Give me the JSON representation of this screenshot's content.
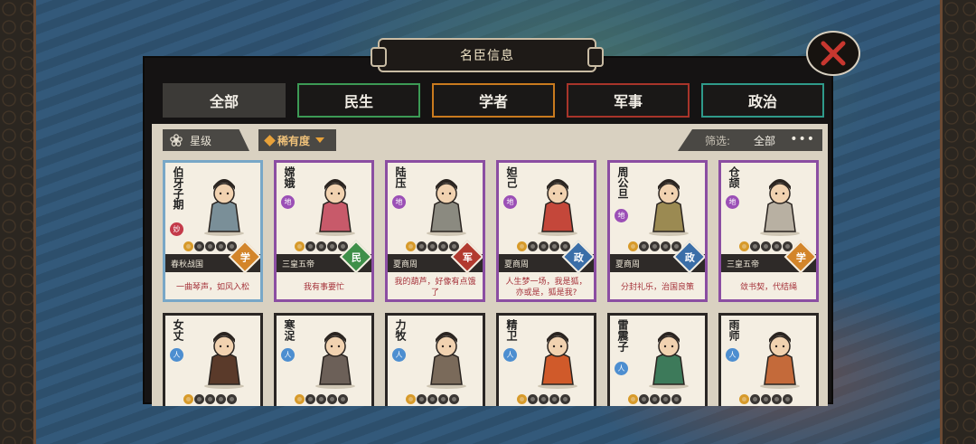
{
  "header": {
    "title": "名臣信息"
  },
  "tabs": [
    {
      "label": "全部",
      "key": "all"
    },
    {
      "label": "民生",
      "key": "min"
    },
    {
      "label": "学者",
      "key": "xue"
    },
    {
      "label": "军事",
      "key": "jun"
    },
    {
      "label": "政治",
      "key": "zheng"
    }
  ],
  "filters": {
    "star_label": "星级",
    "rarity_label": "稀有度",
    "filter_label": "筛选:",
    "filter_value": "全部",
    "more": "•••"
  },
  "cards": [
    {
      "name": "伯牙子期",
      "badge": "妙",
      "stars": 5,
      "dynasty": "春秋战国",
      "category": "学",
      "quote": "一曲琴声，如风入松"
    },
    {
      "name": "嫦娥",
      "badge": "地",
      "stars": 5,
      "dynasty": "三皇五帝",
      "category": "民",
      "quote": "我有事要忙"
    },
    {
      "name": "陆压",
      "badge": "地",
      "stars": 5,
      "dynasty": "夏商周",
      "category": "军",
      "quote": "我的葫芦，好像有点饿了"
    },
    {
      "name": "妲己",
      "badge": "地",
      "stars": 5,
      "dynasty": "夏商周",
      "category": "政",
      "quote": "人生梦一场，我是狐，亦或是，狐是我?"
    },
    {
      "name": "周公旦",
      "badge": "地",
      "stars": 5,
      "dynasty": "夏商周",
      "category": "政",
      "quote": "分封礼乐，治国良策"
    },
    {
      "name": "仓颉",
      "badge": "地",
      "stars": 5,
      "dynasty": "三皇五帝",
      "category": "学",
      "quote": "敛书契，代结绳"
    },
    {
      "name": "女丈",
      "badge": "人",
      "stars": 4
    },
    {
      "name": "寒浞",
      "badge": "人",
      "stars": 4
    },
    {
      "name": "力牧",
      "badge": "人",
      "stars": 4
    },
    {
      "name": "精卫",
      "badge": "人",
      "stars": 4
    },
    {
      "name": "雷震子",
      "badge": "人",
      "stars": 4
    },
    {
      "name": "雨师",
      "badge": "人",
      "stars": 4
    }
  ],
  "colors": {
    "rare_border": "#8b4ea2",
    "legend_border": "#78a7c7",
    "common_border": "#2a2624",
    "cat_xue": "#d3852a",
    "cat_min": "#3e8f49",
    "cat_jun": "#b23a2f",
    "cat_zheng": "#3a6ea8"
  }
}
